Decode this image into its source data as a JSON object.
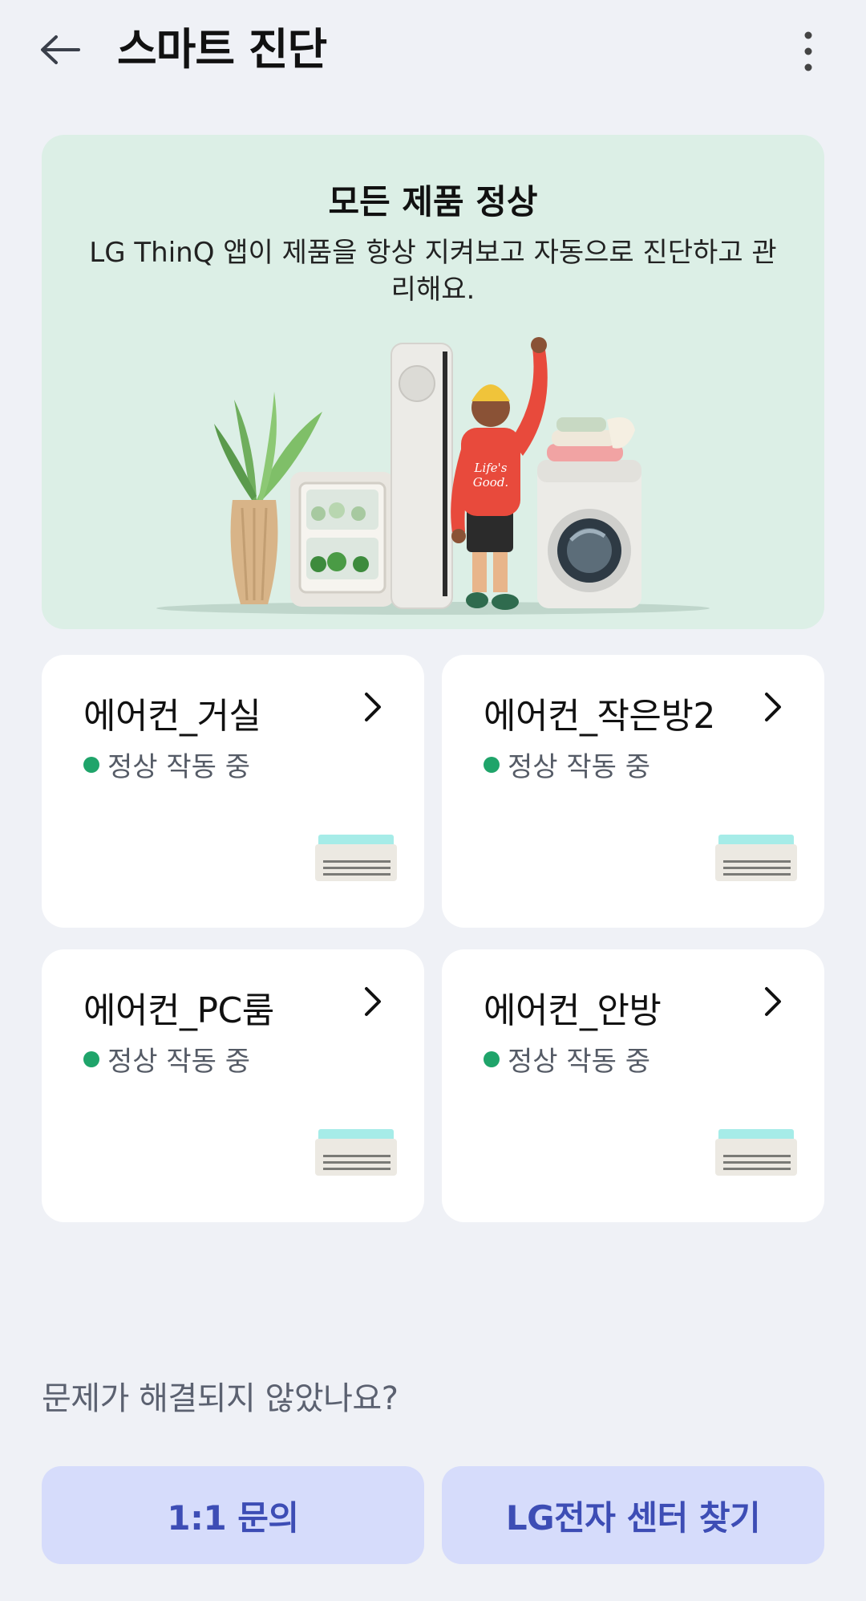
{
  "header": {
    "title": "스마트 진단",
    "back_icon": "arrow-left-icon",
    "more_icon": "more-vertical-icon"
  },
  "hero": {
    "title": "모든 제품 정상",
    "description": "LG ThinQ 앱이 제품을 항상 지켜보고 자동으로 진단하고 관리해요.",
    "shirt_text_1": "Life's",
    "shirt_text_2": "Good.",
    "background_color": "#dcefe6"
  },
  "devices": [
    {
      "name": "에어컨_거실",
      "status": "정상 작동 중",
      "icon": "air-conditioner-icon"
    },
    {
      "name": "에어컨_작은방2",
      "status": "정상 작동 중",
      "icon": "air-conditioner-icon"
    },
    {
      "name": "에어컨_PC룸",
      "status": "정상 작동 중",
      "icon": "air-conditioner-icon"
    },
    {
      "name": "에어컨_안방",
      "status": "정상 작동 중",
      "icon": "air-conditioner-icon"
    }
  ],
  "status_color": "#1fa46a",
  "help": {
    "question": "문제가 해결되지 않았나요?",
    "inquiry_label": "1:1 문의",
    "center_label": "LG전자 센터 찾기"
  },
  "colors": {
    "background": "#eff1f6",
    "button_bg": "#d6dcfb",
    "button_text": "#3d4db5"
  }
}
